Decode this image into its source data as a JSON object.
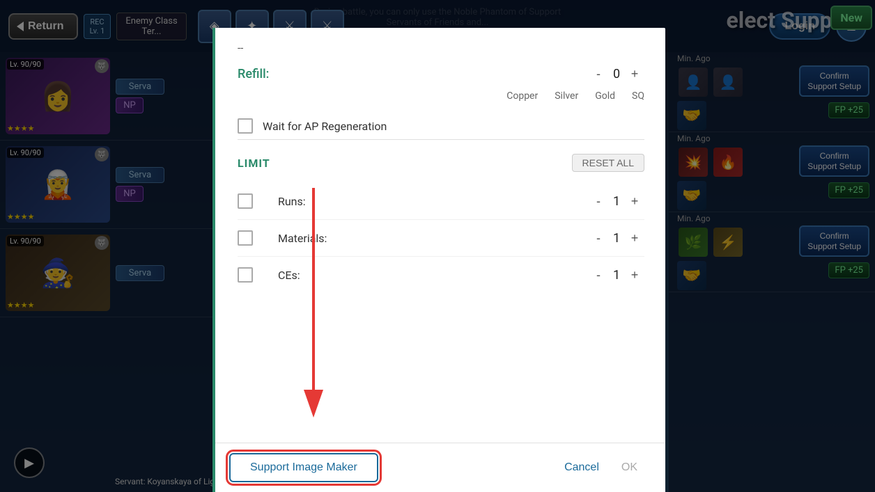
{
  "background": {
    "battle_info": "During battle, you can only use the Noble Phantom of Support Servants of Friends and..."
  },
  "top_bar": {
    "return_label": "Return",
    "rec_label": "REC\nLv. 1",
    "enemy_class_label": "Enemy Class\nTer...\nEne...",
    "nav_icons": [
      "◈",
      "✦",
      "⚔",
      "⚔"
    ],
    "login_label": "Login",
    "new_label": "New"
  },
  "select_support_title": "elect Support",
  "servants": [
    {
      "lv": "Lv. 90/90",
      "portrait_type": "purple",
      "portrait_emoji": "👧",
      "stars": "★★★★",
      "tags": [
        "Serva",
        "NP"
      ]
    },
    {
      "lv": "Lv. 90/90",
      "portrait_type": "blue",
      "portrait_emoji": "🧝",
      "stars": "★★★★",
      "tags": [
        "Serva",
        "NP"
      ]
    },
    {
      "lv": "Lv. 90/90",
      "portrait_type": "brown",
      "portrait_emoji": "🧙",
      "stars": "★★★★",
      "tags": [
        "Serva"
      ]
    }
  ],
  "right_panel": {
    "cards": [
      {
        "min_ago": "Min. Ago",
        "confirm_label": "Confirm\nSupport Setup",
        "fp_label": "FP +25"
      },
      {
        "min_ago": "Min. Ago",
        "confirm_label": "Confirm\nSupport Setup",
        "fp_label": "FP +25"
      },
      {
        "min_ago": "Min. Ago",
        "confirm_label": "Confirm\nSupport Setup",
        "fp_label": "FP +25"
      }
    ]
  },
  "servant_name_bottom": "Servant: Koyanskaya of Light",
  "dialog": {
    "dash_label": "--",
    "refill_label": "Refill:",
    "refill_minus": "-",
    "refill_value": "0",
    "refill_plus": "+",
    "currency_labels": [
      "Copper",
      "Silver",
      "Gold",
      "SQ"
    ],
    "wait_for_ap_label": "Wait for AP Regeneration",
    "limit_section_label": "LIMIT",
    "reset_all_label": "RESET ALL",
    "runs_label": "Runs:",
    "runs_minus": "-",
    "runs_value": "1",
    "runs_plus": "+",
    "materials_label": "Materials:",
    "materials_minus": "-",
    "materials_value": "1",
    "materials_plus": "+",
    "ces_label": "CEs:",
    "ces_minus": "-",
    "ces_value": "1",
    "ces_plus": "+",
    "support_image_maker_label": "Support Image Maker",
    "cancel_label": "Cancel",
    "ok_label": "OK"
  },
  "arrow": {
    "color": "#e53935"
  }
}
